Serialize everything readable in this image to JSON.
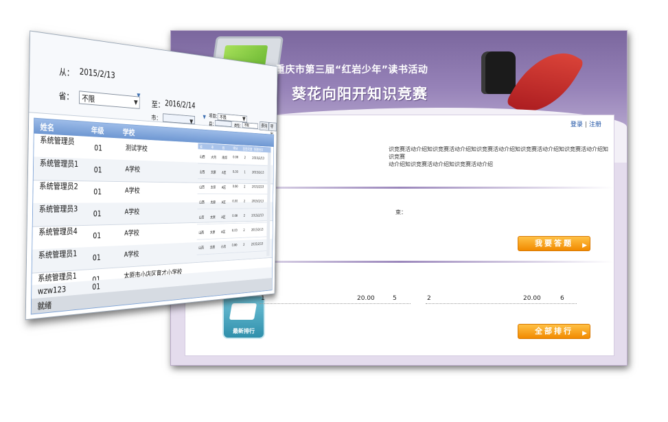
{
  "site": {
    "banner_title": "重庆市第三届“红岩少年”读书活动",
    "banner_subtitle": "葵花向阳开知识竞赛",
    "login": "登录",
    "sep": "|",
    "register": "注册",
    "intro_line1": "识竞赛活动介绍知识竞赛活动介绍知识竞赛活动介绍知识竞赛活动介绍知识竞赛活动介绍知识竞赛",
    "intro_line2": "动介绍知识竞赛活动介绍知识竞赛活动介绍",
    "end_label": "束：",
    "answer_btn": "我要答题",
    "rank_btn": "全部排行",
    "latest_label": "最新排行",
    "rank": [
      {
        "rank": "1",
        "score": "20.00",
        "count": "5"
      },
      {
        "rank": "2",
        "score": "20.00",
        "count": "6"
      }
    ],
    "colors": {
      "banner": "#8e7ab2",
      "button": "#f39a10"
    }
  },
  "admin": {
    "from_label": "从：",
    "from_date": "2015/2/13",
    "to_label": "至：",
    "to_date": "2016/2/14",
    "province_label": "省：",
    "province_value": "不限",
    "city_label": "市：",
    "county_label": "县：",
    "project_label": "项目：",
    "project_value": "不限",
    "type_label": "类型：",
    "type_value": "不限",
    "query_btn": "查询",
    "export_btn": "导出",
    "columns": {
      "name": "姓名",
      "grade": "年级",
      "school": "学校"
    },
    "rows": [
      {
        "name": "系统管理员",
        "grade": "01",
        "school": "测试学校"
      },
      {
        "name": "系统管理员1",
        "grade": "01",
        "school": "A学校"
      },
      {
        "name": "系统管理员2",
        "grade": "01",
        "school": "A学校"
      },
      {
        "name": "系统管理员3",
        "grade": "01",
        "school": "A学校"
      },
      {
        "name": "系统管理员4",
        "grade": "01",
        "school": "A学校"
      },
      {
        "name": "系统管理员1",
        "grade": "01",
        "school": "A学校"
      },
      {
        "name": "系统管理员1",
        "grade": "01",
        "school": "太原市小店区育才小学校"
      },
      {
        "name": "wzw123",
        "grade": "01",
        "school": ""
      }
    ],
    "sub_columns": [
      "省",
      "市",
      "县",
      "得分",
      "答题次数",
      "答题时间"
    ],
    "sub_rows": [
      [
        "山西",
        "大同",
        "南郊",
        "0.00",
        "2",
        "2015/2/13"
      ],
      [
        "山西",
        "太原",
        "A区",
        "0.00",
        "1",
        "2015/2/13"
      ],
      [
        "山西",
        "太原",
        "A区",
        "0.00",
        "2",
        "2015/2/13"
      ],
      [
        "山西",
        "太原",
        "A区",
        "0.00",
        "2",
        "2015/2/13"
      ],
      [
        "山西",
        "太原",
        "A区",
        "0.00",
        "2",
        "2015/2/13"
      ],
      [
        "山西",
        "太原",
        "A区",
        "0.00",
        "2",
        "2015/2/13"
      ],
      [
        "山西",
        "太原",
        "小店",
        "0.00",
        "2",
        "2015/2/13"
      ]
    ],
    "status": "就绪",
    "colors": {
      "header": "#7ea3d6"
    }
  }
}
